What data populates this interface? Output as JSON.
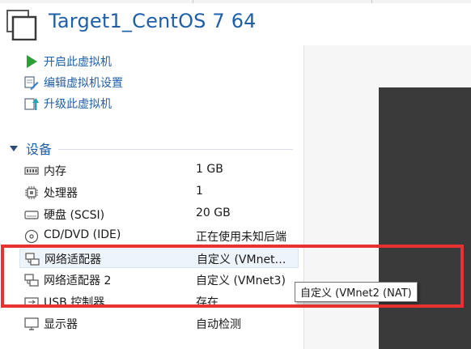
{
  "vm": {
    "title": "Target1_CentOS 7 64"
  },
  "actions": [
    {
      "label": "开启此虚拟机",
      "icon": "play-icon"
    },
    {
      "label": "编辑虚拟机设置",
      "icon": "edit-settings-icon"
    },
    {
      "label": "升级此虚拟机",
      "icon": "upgrade-icon"
    }
  ],
  "devices_section": {
    "title": "设备",
    "rows": [
      {
        "name": "内存",
        "value": "1 GB",
        "icon": "memory-icon"
      },
      {
        "name": "处理器",
        "value": "1",
        "icon": "processor-icon"
      },
      {
        "name": "硬盘 (SCSI)",
        "value": "20 GB",
        "icon": "hard-disk-icon"
      },
      {
        "name": "CD/DVD (IDE)",
        "value": "正在使用未知后端",
        "icon": "cd-dvd-icon"
      },
      {
        "name": "网络适配器",
        "value": "自定义 (VMnet…",
        "icon": "network-adapter-icon"
      },
      {
        "name": "网络适配器 2",
        "value": "自定义 (VMnet3)",
        "icon": "network-adapter-icon"
      },
      {
        "name": "USB 控制器",
        "value": "存在",
        "icon": "usb-icon"
      },
      {
        "name": "显示器",
        "value": "自动检测",
        "icon": "display-icon"
      }
    ]
  },
  "tooltip": {
    "text": "自定义 (VMnet2 (NAT)"
  },
  "colors": {
    "accent": "#1f5fa8",
    "highlight_box": "#e8322f",
    "play_green": "#2e9e3a"
  }
}
